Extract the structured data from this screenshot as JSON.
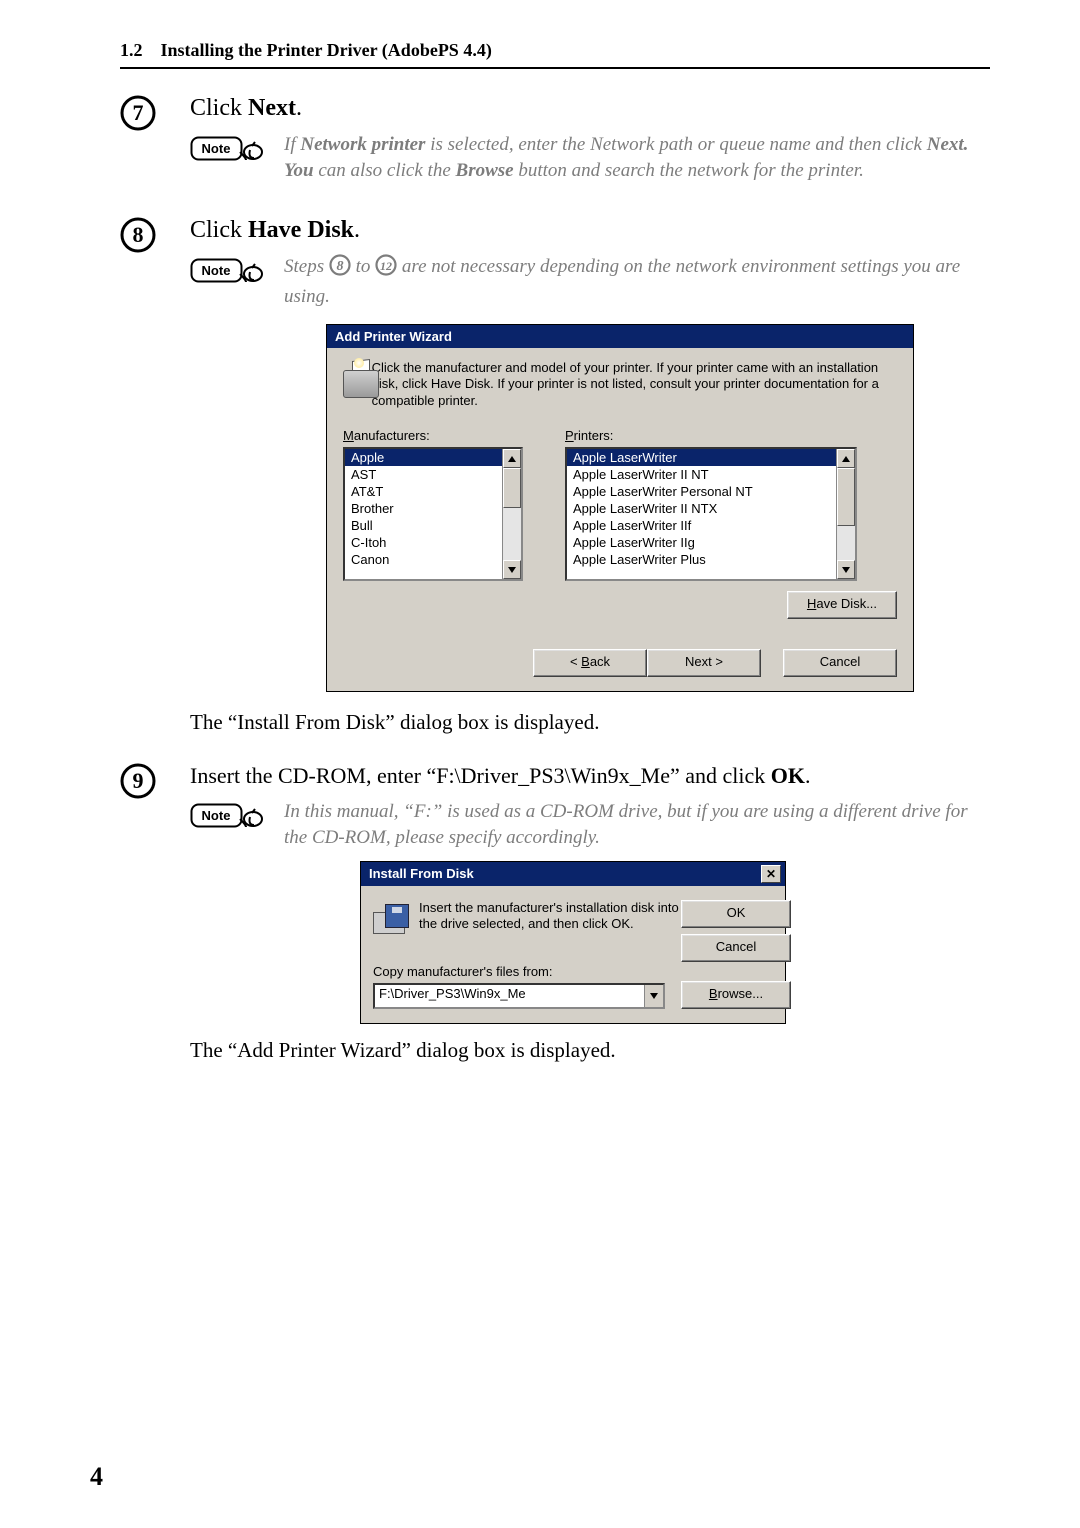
{
  "header": {
    "section_no": "1.2",
    "section_title": "Installing the Printer Driver (AdobePS 4.4)"
  },
  "steps": {
    "s7": {
      "num": "7",
      "title_pre": "Click ",
      "title_bold": "Next",
      "title_post": ".",
      "note": "If Network printer is selected, enter the Network path or queue name and then click Next. You can also click the Browse button and search the network for the printer.",
      "note_bold1": "Network printer",
      "note_bold2": "Next. You",
      "note_bold3": "Browse"
    },
    "s8": {
      "num": "8",
      "title_pre": "Click ",
      "title_bold": "Have Disk",
      "title_post": ".",
      "note_pre": "Steps ",
      "note_mid": " to ",
      "note_post": " are not necessary depending on the network environment settings you are using.",
      "ref_a": "8",
      "ref_b": "12"
    },
    "s9": {
      "num": "9",
      "title_pre": "Insert the CD-ROM, enter “F:\\Driver_PS3\\Win9x_Me” and click ",
      "title_bold": "OK",
      "title_post": ".",
      "note": "In this manual, “F:” is used as a CD-ROM drive, but if you are using a different drive for the CD-ROM, please specify accordingly."
    }
  },
  "wizard": {
    "title": "Add Printer Wizard",
    "desc": "Click the manufacturer and model of your printer. If your printer came with an installation disk, click Have Disk. If your printer is not listed, consult your printer documentation for a compatible printer.",
    "manu_label_u": "M",
    "manu_label_rest": "anufacturers:",
    "prn_label_u": "P",
    "prn_label_rest": "rinters:",
    "manu_items": [
      "Apple",
      "AST",
      "AT&T",
      "Brother",
      "Bull",
      "C-Itoh",
      "Canon"
    ],
    "prn_items": [
      "Apple LaserWriter",
      "Apple LaserWriter II NT",
      "Apple LaserWriter Personal NT",
      "Apple LaserWriter II NTX",
      "Apple LaserWriter IIf",
      "Apple LaserWriter IIg",
      "Apple LaserWriter Plus"
    ],
    "have_disk_u": "H",
    "have_disk_rest": "ave Disk...",
    "back_lt": "< ",
    "back_u": "B",
    "back_rest": "ack",
    "next_label": "Next >",
    "cancel_label": "Cancel"
  },
  "caption1": "The “Install From Disk” dialog box is displayed.",
  "ifd": {
    "title": "Install From Disk",
    "text": "Insert the manufacturer's installation disk into the drive selected, and then click OK.",
    "copy_label": "Copy manufacturer's files from:",
    "path": "F:\\Driver_PS3\\Win9x_Me",
    "ok": "OK",
    "cancel": "Cancel",
    "browse_u": "B",
    "browse_rest": "rowse..."
  },
  "caption2": "The “Add Printer Wizard” dialog box is displayed.",
  "note_label": "Note",
  "pagenum": "4"
}
